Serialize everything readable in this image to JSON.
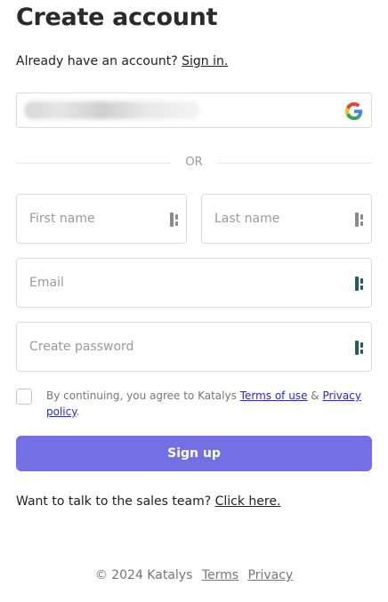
{
  "page": {
    "title": "Create account"
  },
  "signin": {
    "prompt": "Already have an account?",
    "link": "Sign in."
  },
  "google": {
    "icon": "google-icon"
  },
  "divider": {
    "text": "OR"
  },
  "form": {
    "first_name": {
      "placeholder": "First name",
      "value": ""
    },
    "last_name": {
      "placeholder": "Last name",
      "value": ""
    },
    "email": {
      "placeholder": "Email",
      "value": ""
    },
    "password": {
      "placeholder": "Create password",
      "value": ""
    },
    "field_icon": "password-manager-icon"
  },
  "terms": {
    "prefix": "By continuing, you agree to Katalys",
    "terms_link": "Terms of use",
    "amp": "&",
    "privacy_link": "Privacy policy",
    "suffix": ".",
    "checked": false
  },
  "signup": {
    "label": "Sign up",
    "color": "#7470e4"
  },
  "sales": {
    "prompt": "Want to talk to the sales team?",
    "link": "Click here."
  },
  "footer": {
    "copyright": "© 2024 Katalys",
    "terms": "Terms",
    "privacy": "Privacy"
  }
}
